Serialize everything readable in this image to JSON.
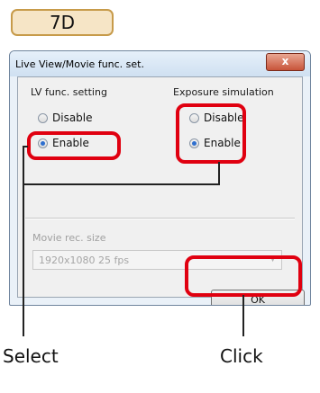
{
  "badge": {
    "label": "7D"
  },
  "dialog": {
    "title": "Live View/Movie func. set.",
    "close_label": "x",
    "lv_group": {
      "label": "LV func. setting",
      "options": [
        {
          "label": "Disable",
          "selected": false
        },
        {
          "label": "Enable",
          "selected": true
        }
      ]
    },
    "exposure_group": {
      "label": "Exposure simulation",
      "options": [
        {
          "label": "Disable",
          "selected": false
        },
        {
          "label": "Enable",
          "selected": true
        }
      ]
    },
    "movie": {
      "label": "Movie rec. size",
      "value": "1920x1080  25 fps",
      "enabled": false
    },
    "ok_label": "OK"
  },
  "annotations": {
    "select_label": "Select",
    "click_label": "Click",
    "highlight_color": "#e00010"
  }
}
